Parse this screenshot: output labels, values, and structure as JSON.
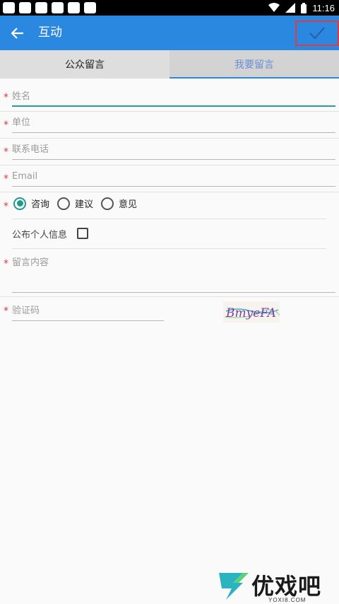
{
  "status_bar": {
    "time": "11:16",
    "notification_count": 6
  },
  "app_bar": {
    "title": "互动"
  },
  "tabs": [
    {
      "label": "公众留言",
      "selected": false
    },
    {
      "label": "我要留言",
      "selected": true
    }
  ],
  "form": {
    "required_mark": "*",
    "name": {
      "placeholder": "姓名"
    },
    "unit": {
      "placeholder": "单位"
    },
    "phone": {
      "placeholder": "联系电话"
    },
    "email": {
      "placeholder": "Email"
    },
    "type_options": [
      "咨询",
      "建议",
      "意见"
    ],
    "type_selected": "咨询",
    "publish_label": "公布个人信息",
    "publish_checked": false,
    "content": {
      "placeholder": "留言内容"
    },
    "captcha": {
      "placeholder": "验证码",
      "image_text": "BmyeFA"
    }
  },
  "watermark": {
    "brand": "优戏吧",
    "domain": "YOXI8.COM"
  },
  "colors": {
    "primary": "#2b88e0",
    "accent": "#1f9a8c",
    "required": "#e23b3b",
    "highlight_box": "#e23b3b"
  }
}
